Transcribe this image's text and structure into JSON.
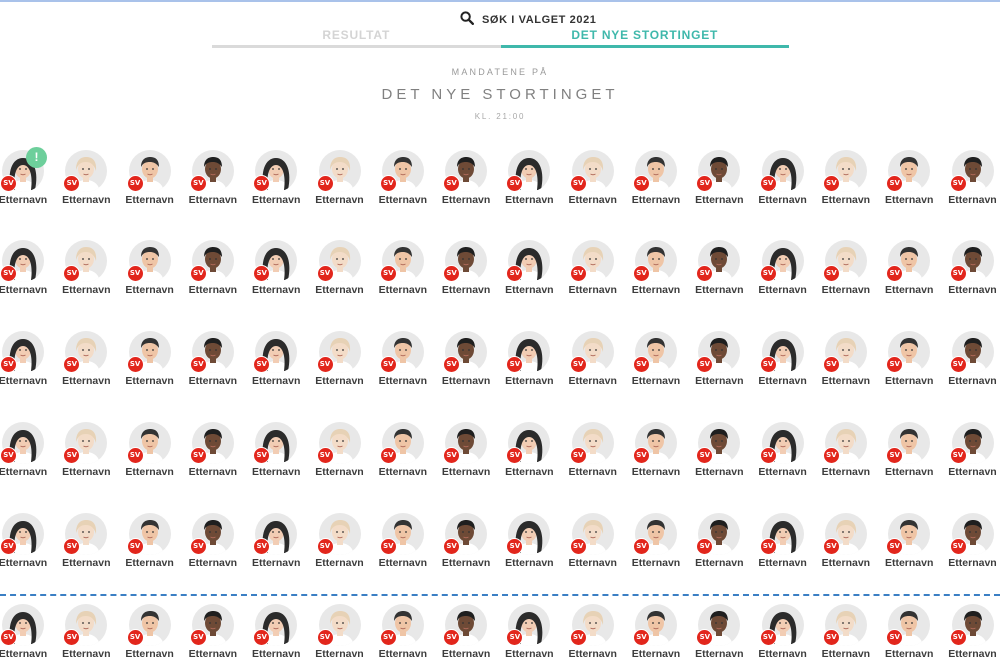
{
  "search": {
    "label": "SØK I VALGET 2021",
    "icon": "search-icon"
  },
  "tabs": [
    {
      "label": "RESULTAT",
      "active": false
    },
    {
      "label": "DET NYE STORTINGET",
      "active": true
    }
  ],
  "header": {
    "kicker": "MANDATENE PÅ",
    "title": "DET NYE STORTINGET",
    "time": "KL. 21:00"
  },
  "seat_defaults": {
    "party": "SV",
    "name": "Etternavn"
  },
  "seat_rows": 6,
  "seats_per_row": 16,
  "alert_seat": {
    "row": 0,
    "col": 0,
    "label": "!"
  },
  "colors": {
    "accent": "#3fb8ab",
    "party_badge": "#e2261c",
    "alert": "#6dcf9b",
    "majority_line": "#3b7fc4"
  }
}
